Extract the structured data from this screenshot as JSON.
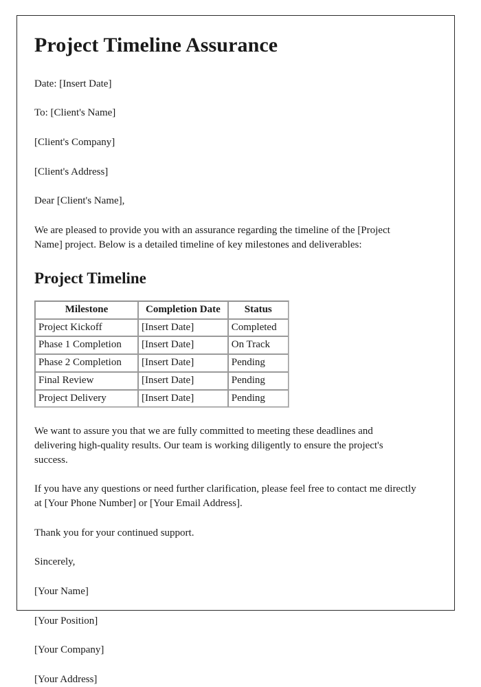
{
  "document": {
    "title": "Project Timeline Assurance",
    "meta_lines": [
      "Date: [Insert Date]",
      "To: [Client's Name]",
      "[Client's Company]",
      "[Client's Address]",
      "Dear [Client's Name],"
    ],
    "intro_paragraph": "We are pleased to provide you with an assurance regarding the timeline of the [Project Name] project. Below is a detailed timeline of key milestones and deliverables:",
    "section_heading": "Project Timeline",
    "table": {
      "headers": [
        "Milestone",
        "Completion Date",
        "Status"
      ],
      "rows": [
        [
          "Project Kickoff",
          "[Insert Date]",
          "Completed"
        ],
        [
          "Phase 1 Completion",
          "[Insert Date]",
          "On Track"
        ],
        [
          "Phase 2 Completion",
          "[Insert Date]",
          "Pending"
        ],
        [
          "Final Review",
          "[Insert Date]",
          "Pending"
        ],
        [
          "Project Delivery",
          "[Insert Date]",
          "Pending"
        ]
      ]
    },
    "commitment_paragraph": "We want to assure you that we are fully committed to meeting these deadlines and delivering high-quality results. Our team is working diligently to ensure the project's success.",
    "contact_paragraph": "If you have any questions or need further clarification, please feel free to contact me directly at [Your Phone Number] or [Your Email Address].",
    "thanks_line": "Thank you for your continued support.",
    "closing_line": "Sincerely,",
    "signature_lines": [
      "[Your Name]",
      "[Your Position]",
      "[Your Company]",
      "[Your Address]"
    ]
  },
  "colors": {
    "text": "#1a1a1a",
    "page_border": "#2b2b2b",
    "table_border": "#9a9a9a",
    "background": "#ffffff"
  }
}
